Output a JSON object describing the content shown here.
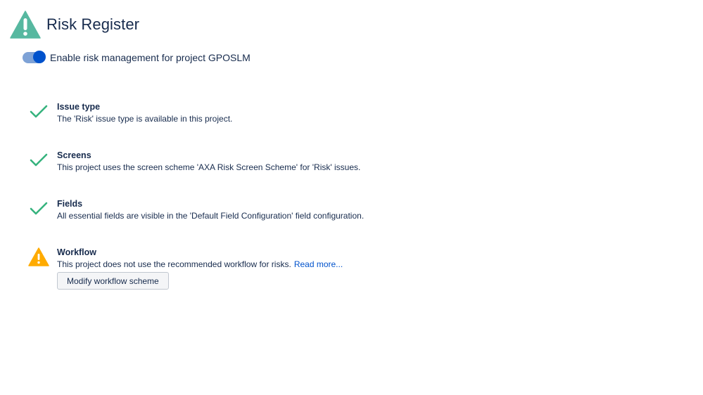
{
  "header": {
    "title": "Risk Register",
    "logo_icon": "warning-triangle-icon",
    "logo_color": "#57b8a0"
  },
  "toggle": {
    "label": "Enable risk management for project GPOSLM",
    "state": "on",
    "accent": "#0052cc"
  },
  "checks": [
    {
      "title": "Issue type",
      "description": "The 'Risk' issue type is available in this project.",
      "status": "ok",
      "icon": "check-icon"
    },
    {
      "title": "Screens",
      "description": "This project uses the screen scheme 'AXA Risk Screen Scheme' for 'Risk' issues.",
      "status": "ok",
      "icon": "check-icon"
    },
    {
      "title": "Fields",
      "description": "All essential fields are visible in the 'Default Field Configuration' field configuration.",
      "status": "ok",
      "icon": "check-icon"
    },
    {
      "title": "Workflow",
      "description": "This project does not use the recommended workflow for risks.",
      "link_text": "Read more...",
      "button_label": "Modify workflow scheme",
      "status": "warning",
      "icon": "warning-icon"
    }
  ],
  "colors": {
    "ok": "#36b37e",
    "warning": "#ffab00",
    "text": "#172b4d",
    "link": "#0052cc"
  }
}
